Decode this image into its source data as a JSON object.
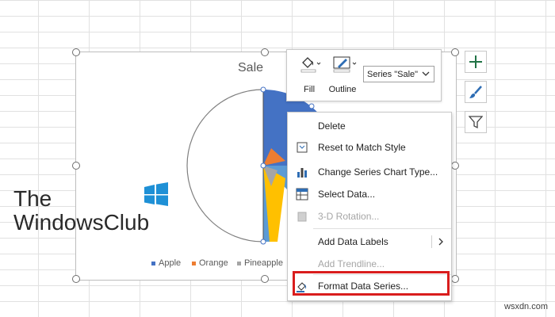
{
  "chart": {
    "title": "Sale",
    "legend": [
      {
        "label": "Apple",
        "color": "#4472c4"
      },
      {
        "label": "Orange",
        "color": "#ed7d31"
      },
      {
        "label": "Pineapple",
        "color": "#a5a5a5"
      }
    ]
  },
  "toolbar": {
    "fill_label": "Fill",
    "outline_label": "Outline",
    "series_select": "Series \"Sale\""
  },
  "side_buttons": [
    "plus-icon",
    "brush-icon",
    "filter-icon"
  ],
  "menu": {
    "items": [
      {
        "label": "Delete",
        "icon": "delete-icon",
        "enabled": true
      },
      {
        "label": "Reset to Match Style",
        "icon": "reset-style-icon",
        "enabled": true
      },
      {
        "label": "Change Series Chart Type...",
        "icon": "chart-type-icon",
        "enabled": true
      },
      {
        "label": "Select Data...",
        "icon": "select-data-icon",
        "enabled": true
      },
      {
        "label": "3-D Rotation...",
        "icon": "rotation-icon",
        "enabled": false
      },
      {
        "label": "Add Data Labels",
        "icon": "",
        "enabled": true,
        "submenu": true
      },
      {
        "label": "Add Trendline...",
        "icon": "",
        "enabled": false
      },
      {
        "label": "Format Data Series...",
        "icon": "format-series-icon",
        "enabled": true
      }
    ]
  },
  "watermark": {
    "line1": "The",
    "line2": "WindowsClub"
  },
  "site": "wsxdn.com",
  "colors": {
    "accent": "#217346",
    "highlight": "#d91d1d"
  }
}
